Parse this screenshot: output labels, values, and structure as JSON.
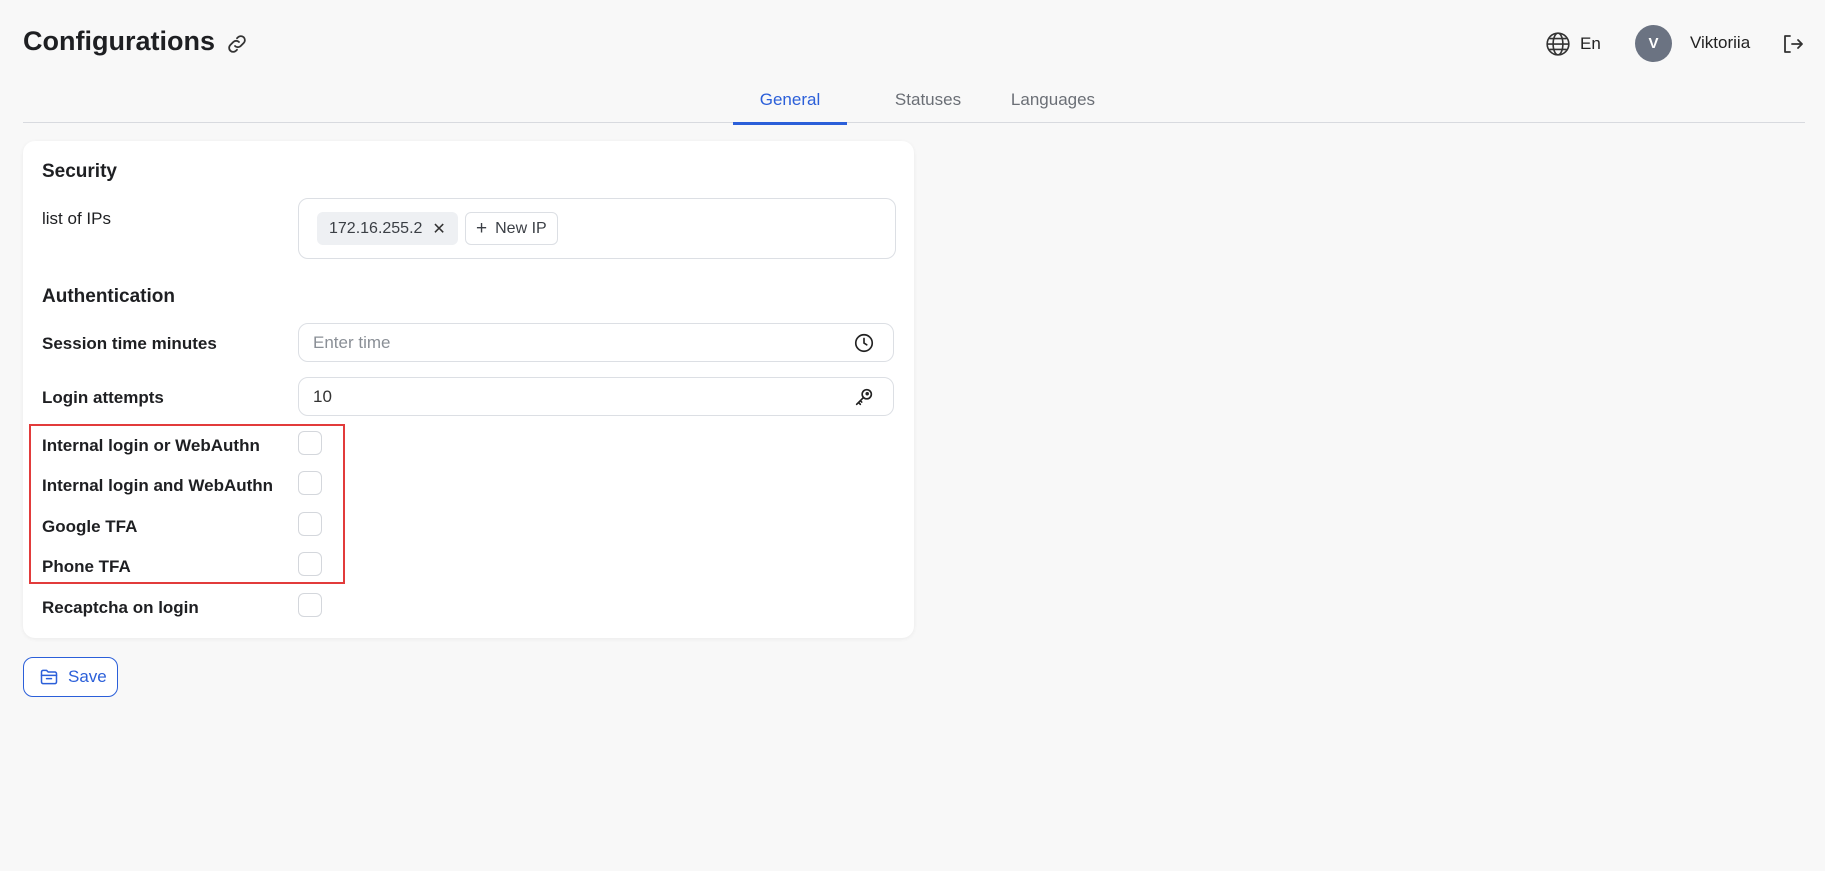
{
  "header": {
    "title": "Configurations",
    "language": "En",
    "user_initial": "V",
    "user_name": "Viktoriia"
  },
  "tabs": [
    {
      "label": "General",
      "active": true
    },
    {
      "label": "Statuses",
      "active": false
    },
    {
      "label": "Languages",
      "active": false
    }
  ],
  "security": {
    "title": "Security",
    "ip_label": "list of IPs",
    "ips": [
      "172.16.255.2"
    ],
    "new_ip_label": "New IP"
  },
  "authentication": {
    "title": "Authentication",
    "session_label": "Session time minutes",
    "session_placeholder": "Enter time",
    "session_value": "",
    "login_attempts_label": "Login attempts",
    "login_attempts_value": "10",
    "checkboxes": [
      {
        "label": "Internal login or WebAuthn",
        "checked": false
      },
      {
        "label": "Internal login and WebAuthn",
        "checked": false
      },
      {
        "label": "Google TFA",
        "checked": false
      },
      {
        "label": "Phone TFA",
        "checked": false
      },
      {
        "label": "Recaptcha on login",
        "checked": false
      }
    ]
  },
  "actions": {
    "save_label": "Save"
  },
  "colors": {
    "accent": "#2b5fd9",
    "highlight": "#e23b3b",
    "avatar": "#6b7382"
  },
  "icons": {
    "title_action": "link-icon",
    "language": "globe-icon",
    "logout": "logout-icon",
    "session": "clock-icon",
    "login_attempts": "key-icon",
    "save": "folder-icon"
  }
}
